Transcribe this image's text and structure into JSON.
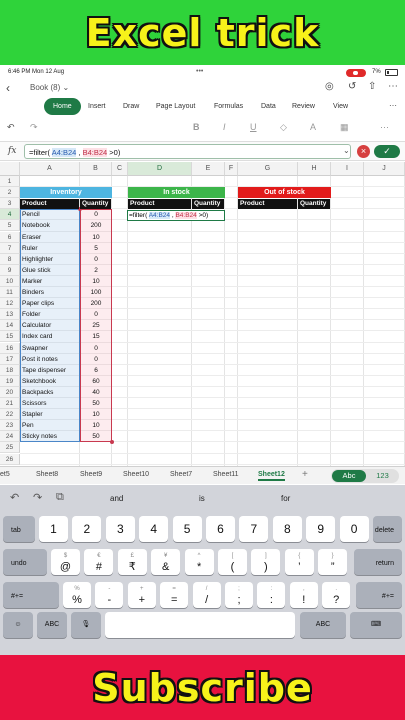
{
  "banner_top": "Excel trick",
  "banner_bottom": "Subscribe",
  "status": {
    "time": "6:46 PM  Mon 12 Aug",
    "dots": "•••",
    "battery": "7%"
  },
  "titlebar": {
    "doc_name": "Book (8)"
  },
  "ribbon": {
    "tabs": [
      "Home",
      "Insert",
      "Draw",
      "Page Layout",
      "Formulas",
      "Data",
      "Review",
      "View"
    ],
    "active": "Home"
  },
  "tool_icons": [
    "undo-icon",
    "redo-icon",
    "bold-icon",
    "italic-icon",
    "underline-icon",
    "fill-color-icon",
    "font-color-icon",
    "borders-icon",
    "more-icon"
  ],
  "formula_bar": {
    "fx": "fx",
    "pre": "=filter( ",
    "ref1": "A4:B24",
    "mid": " , ",
    "ref2": "B4:B24",
    "post": " >0)"
  },
  "columns": [
    "A",
    "B",
    "C",
    "D",
    "E",
    "F",
    "G",
    "H",
    "I",
    "J"
  ],
  "rows": [
    "1",
    "2",
    "3",
    "4",
    "5",
    "6",
    "7",
    "8",
    "9",
    "10",
    "11",
    "12",
    "13",
    "14",
    "15",
    "16",
    "17",
    "18",
    "19",
    "20",
    "21",
    "22",
    "23",
    "24",
    "25",
    "26"
  ],
  "sheet": {
    "inventory_title": "Inventory",
    "in_stock_title": "In stock",
    "out_of_stock_title": "Out of stock",
    "product_header": "Product",
    "quantity_header": "Quantity",
    "items": [
      {
        "product": "Pencil",
        "qty": "0"
      },
      {
        "product": "Notebook",
        "qty": "200"
      },
      {
        "product": "Eraser",
        "qty": "10"
      },
      {
        "product": "Ruler",
        "qty": "5"
      },
      {
        "product": "Highlighter",
        "qty": "0"
      },
      {
        "product": "Glue stick",
        "qty": "2"
      },
      {
        "product": "Marker",
        "qty": "10"
      },
      {
        "product": "Binders",
        "qty": "100"
      },
      {
        "product": "Paper clips",
        "qty": "200"
      },
      {
        "product": "Folder",
        "qty": "0"
      },
      {
        "product": "Calculator",
        "qty": "25"
      },
      {
        "product": "Index card",
        "qty": "15"
      },
      {
        "product": "Swapner",
        "qty": "0"
      },
      {
        "product": "Post it notes",
        "qty": "0"
      },
      {
        "product": "Tape dispenser",
        "qty": "6"
      },
      {
        "product": "Sketchbook",
        "qty": "60"
      },
      {
        "product": "Backpacks",
        "qty": "40"
      },
      {
        "product": "Scissors",
        "qty": "50"
      },
      {
        "product": "Stapler",
        "qty": "10"
      },
      {
        "product": "Pen",
        "qty": "10"
      },
      {
        "product": "Sticky notes",
        "qty": "50"
      }
    ],
    "active_cell": {
      "pre": "=filter( ",
      "ref1": "A4:B24",
      "mid": " , ",
      "ref2": "B4:B24",
      "post": " >0)"
    }
  },
  "sheet_tabs": [
    "et5",
    "Sheet8",
    "Sheet9",
    "Sheet10",
    "Sheet7",
    "Sheet11",
    "Sheet12"
  ],
  "active_sheet": "Sheet12",
  "input_toggle": {
    "on": "Abc",
    "off": "123"
  },
  "keyboard": {
    "suggestions": [
      "and",
      "is",
      "for"
    ],
    "row1": [
      "tab",
      "1",
      "2",
      "3",
      "4",
      "5",
      "6",
      "7",
      "8",
      "9",
      "0",
      "delete"
    ],
    "row2_alt": [
      "$",
      "€",
      "£",
      "¥",
      "^",
      "[",
      "]",
      "{",
      "}"
    ],
    "row2": [
      "undo",
      "@",
      "#",
      "₹",
      "&",
      "*",
      "(",
      ")",
      "’",
      "”",
      "return"
    ],
    "row3_alt": [
      "%",
      "-",
      "+",
      "=",
      "/",
      ";",
      ":",
      ",",
      "."
    ],
    "row3": [
      "#+=",
      "%",
      "-",
      "+",
      "=",
      "/",
      ";",
      ":",
      "!",
      "?",
      "#+="
    ],
    "row4": [
      "emoji-icon",
      "ABC",
      "mic-icon",
      "space",
      "ABC",
      "keyboard-hide-icon"
    ]
  },
  "colors": {
    "banner_top": "#2fd33a",
    "banner_bottom": "#e8123f",
    "banner_text": "#f7f21a",
    "excel_green": "#1f7a46",
    "inventory": "#4eb5e0",
    "in_stock": "#3cb54a",
    "out_of_stock": "#e21b1b"
  }
}
